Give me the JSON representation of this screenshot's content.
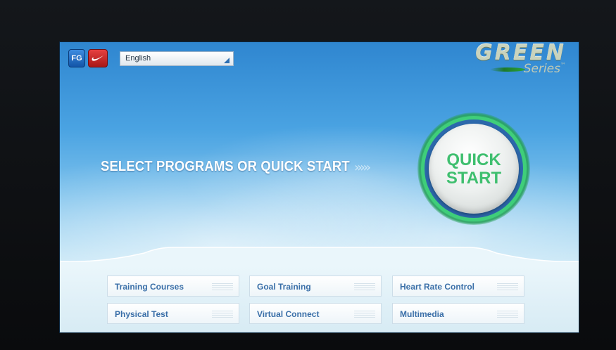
{
  "header": {
    "language_value": "English",
    "brand_main": "GREEN",
    "brand_sub": "Series",
    "brand_tm": "™"
  },
  "main": {
    "prompt": "SELECT PROGRAMS OR QUICK START",
    "chevrons": "›››››",
    "quick_start_line1": "QUICK",
    "quick_start_line2": "START"
  },
  "programs": [
    "Training Courses",
    "Goal Training",
    "Heart Rate Control",
    "Physical Test",
    "Virtual Connect",
    "Multimedia"
  ],
  "colors": {
    "quick_start_text": "#3fbf6f",
    "ring": "#3fce7a",
    "program_text": "#3a6fa8"
  },
  "icons": {
    "fg_logo": "FG",
    "nike_logo": "swoosh"
  }
}
